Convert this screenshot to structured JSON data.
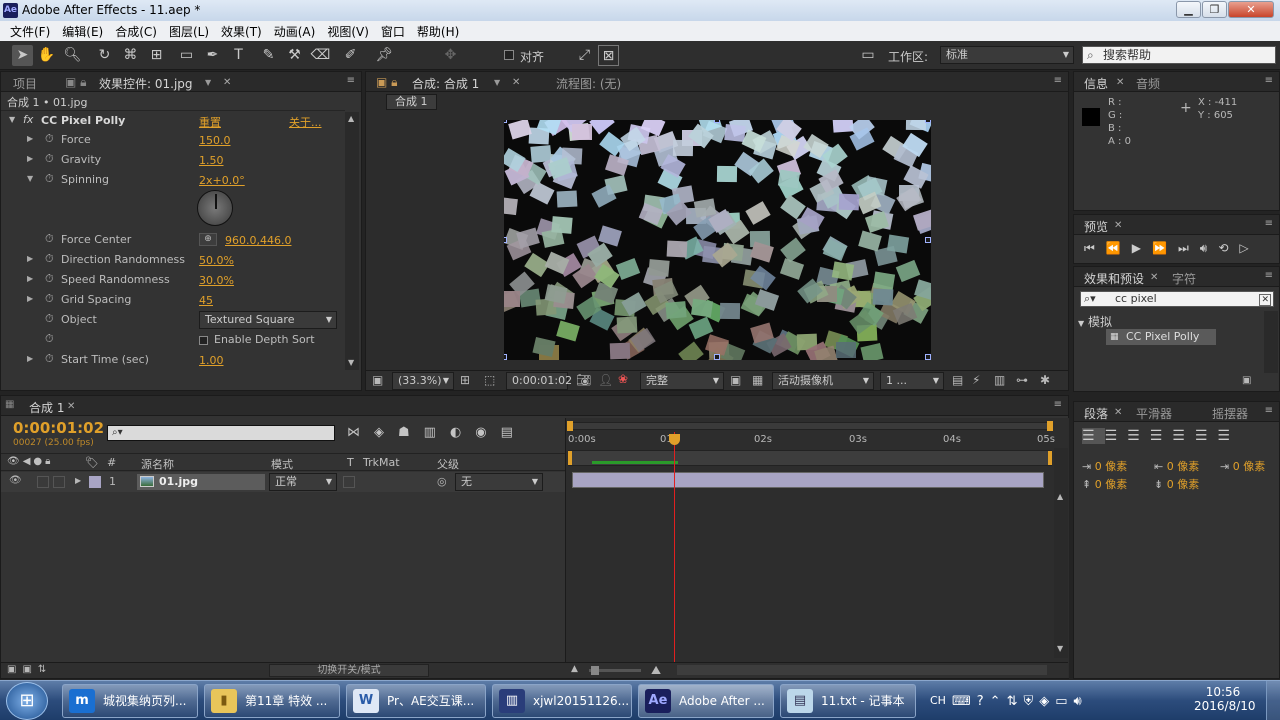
{
  "window": {
    "app_icon": "Ae",
    "title": "Adobe After Effects - 11.aep *"
  },
  "menu": [
    "文件(F)",
    "编辑(E)",
    "合成(C)",
    "图层(L)",
    "效果(T)",
    "动画(A)",
    "视图(V)",
    "窗口",
    "帮助(H)"
  ],
  "toolbar": {
    "snap_label": "对齐",
    "workspace_label": "工作区:",
    "workspace_value": "标准",
    "search_placeholder": "搜索帮助"
  },
  "effect_panel": {
    "tab_project": "项目",
    "tab_effects": "效果控件: 01.jpg",
    "breadcrumb": "合成 1 • 01.jpg",
    "effect_name": "CC Pixel Polly",
    "reset_label": "重置",
    "about_label": "关于...",
    "props": [
      {
        "name": "Force",
        "value": "150.0"
      },
      {
        "name": "Gravity",
        "value": "1.50"
      },
      {
        "name": "Spinning",
        "value": "2x+0.0°"
      },
      {
        "name": "Force Center",
        "value": "960.0,446.0"
      },
      {
        "name": "Direction Randomness",
        "value": "50.0%"
      },
      {
        "name": "Speed Randomness",
        "value": "30.0%"
      },
      {
        "name": "Grid Spacing",
        "value": "45"
      },
      {
        "name": "Object",
        "value": "Textured Square"
      },
      {
        "name": "Enable Depth Sort",
        "value": "off"
      },
      {
        "name": "Start Time (sec)",
        "value": "1.00"
      }
    ]
  },
  "comp_panel": {
    "tab": "合成: 合成 1",
    "flow_tab": "流程图: (无)",
    "comp_button": "合成 1",
    "zoom": "(33.3%)",
    "timecode": "0:00:01:02",
    "resolution": "完整",
    "camera": "活动摄像机",
    "views": "1 ..."
  },
  "info_panel": {
    "tab_info": "信息",
    "tab_audio": "音频",
    "r": "R :",
    "g": "G :",
    "b": "B :",
    "a": "A : 0",
    "x": "X : -411",
    "y": "Y : 605"
  },
  "preview_panel": {
    "tab": "预览"
  },
  "effects_presets": {
    "tab": "效果和预设",
    "tab_char": "字符",
    "search_value": "cc pixel",
    "category": "模拟",
    "item": "CC Pixel Polly"
  },
  "paragraph": {
    "tab": "段落",
    "tab_smoother": "平滑器",
    "tab_wiggler": "摇摆器",
    "indent_value": "0 像素"
  },
  "timeline": {
    "tab": "合成 1",
    "timecode": "0:00:01:02",
    "frames": "00027 (25.00 fps)",
    "columns": {
      "hash": "#",
      "source": "源名称",
      "mode": "模式",
      "t": "T",
      "trkmat": "TrkMat",
      "parent": "父级"
    },
    "ruler": [
      "0:00s",
      "01s",
      "02s",
      "03s",
      "04s",
      "05s"
    ],
    "layer": {
      "index": "1",
      "name": "01.jpg",
      "mode": "正常",
      "parent": "无"
    },
    "toggle_label": "切换开关/模式"
  },
  "taskbar": {
    "tasks": [
      "城视集纳页列...",
      "第11章 特效 ...",
      "Pr、AE交互课...",
      "xjwl20151126...",
      "Adobe After ...",
      "11.txt - 记事本"
    ],
    "ime": "CH",
    "time": "10:56",
    "date": "2016/8/10"
  },
  "colors": {
    "accent": "#e0a02a",
    "panel": "#333333",
    "playhead": "#e02020",
    "layer_bar": "#a8a4c4"
  }
}
